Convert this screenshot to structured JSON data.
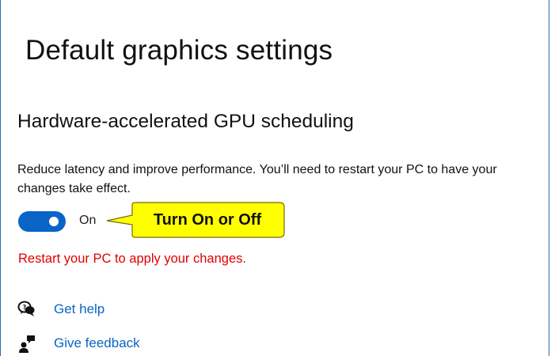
{
  "page": {
    "title": "Default graphics settings"
  },
  "gpu_scheduling": {
    "heading": "Hardware-accelerated GPU scheduling",
    "description": "Reduce latency and improve performance. You’ll need to restart your PC to have your changes take effect.",
    "toggle_state": "On",
    "toggle_on": true,
    "toggle_color": "#0a64c8",
    "restart_warning": "Restart your PC to apply your changes.",
    "warning_color": "#e00000"
  },
  "annotation": {
    "callout_text": "Turn On or Off",
    "callout_color": "#ffff00"
  },
  "links": [
    {
      "icon": "get-help-icon",
      "label": "Get help"
    },
    {
      "icon": "give-feedback-icon",
      "label": "Give feedback"
    }
  ]
}
